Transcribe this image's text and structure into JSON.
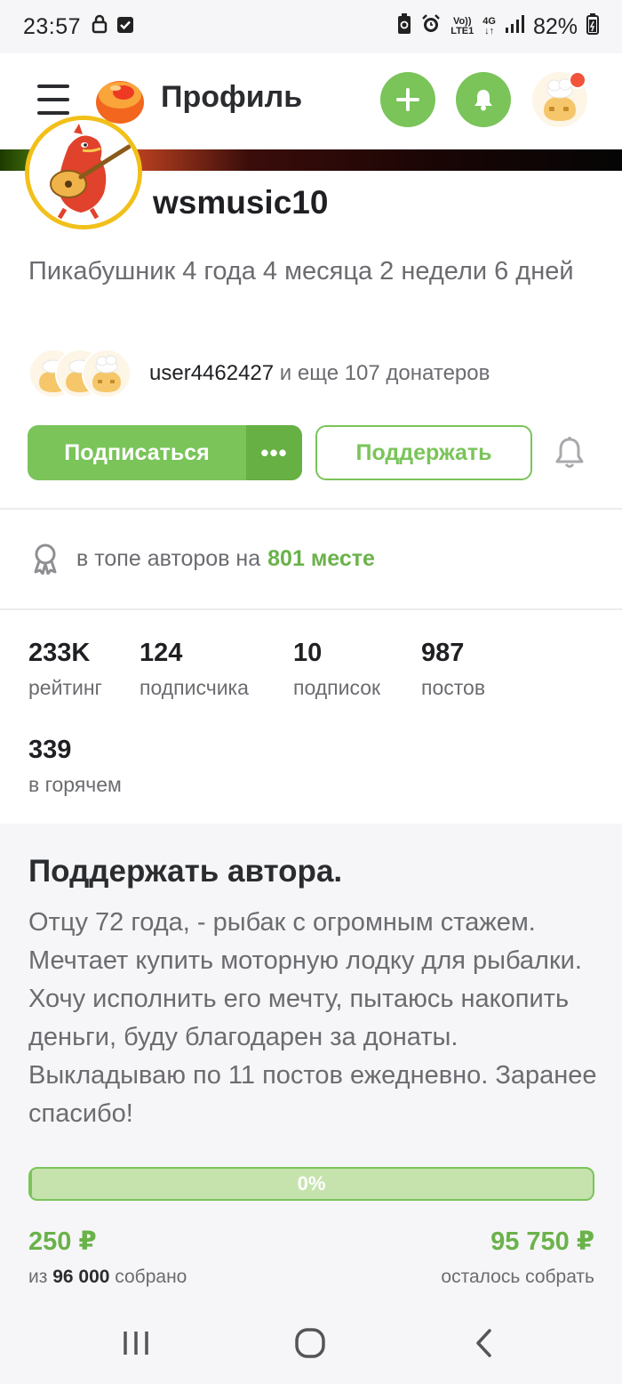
{
  "status_bar": {
    "time": "23:57",
    "network_top": "Vo))",
    "network_bottom": "LTE1",
    "signal_type": "4G",
    "battery": "82%"
  },
  "header": {
    "title": "Профиль",
    "icons": [
      "menu-icon",
      "pikabu-logo",
      "plus-icon",
      "bell-icon",
      "user-avatar"
    ]
  },
  "profile": {
    "username": "wsmusic10",
    "tenure": "Пикабушник 4 года 4 месяца 2 недели 6 дней",
    "donor_name": "user4462427",
    "donor_rest": " и еще 107 донатеров",
    "subscribe_label": "Подписаться",
    "more_label": "•••",
    "support_label": "Поддержать"
  },
  "rank": {
    "prefix": "в топе авторов на",
    "place": "801 месте"
  },
  "stats": [
    {
      "value": "233K",
      "label": "рейтинг"
    },
    {
      "value": "124",
      "label": "подписчика"
    },
    {
      "value": "10",
      "label": "подписок"
    },
    {
      "value": "987",
      "label": "постов"
    },
    {
      "value": "339",
      "label": "в горячем"
    }
  ],
  "donation": {
    "title": "Поддержать автора.",
    "description": "Отцу 72 года, - рыбак с огромным стажем. Мечтает купить моторную лодку для рыбалки. Хочу исполнить его мечту, пытаюсь накопить деньги, буду благодарен за донаты. Выкладываю по 11 постов ежедневно. Заранее спасибо!",
    "progress_label": "0%",
    "progress_fraction": 0.0026,
    "collected": "250 ₽",
    "collected_prefix": "из ",
    "goal": "96 000",
    "collected_suffix": " собрано",
    "remaining": "95 750 ₽",
    "remaining_label": "осталось собрать"
  },
  "colors": {
    "accent_green": "#7ac45a",
    "text_dark": "#1f2023",
    "text_muted": "#6b6c70"
  }
}
